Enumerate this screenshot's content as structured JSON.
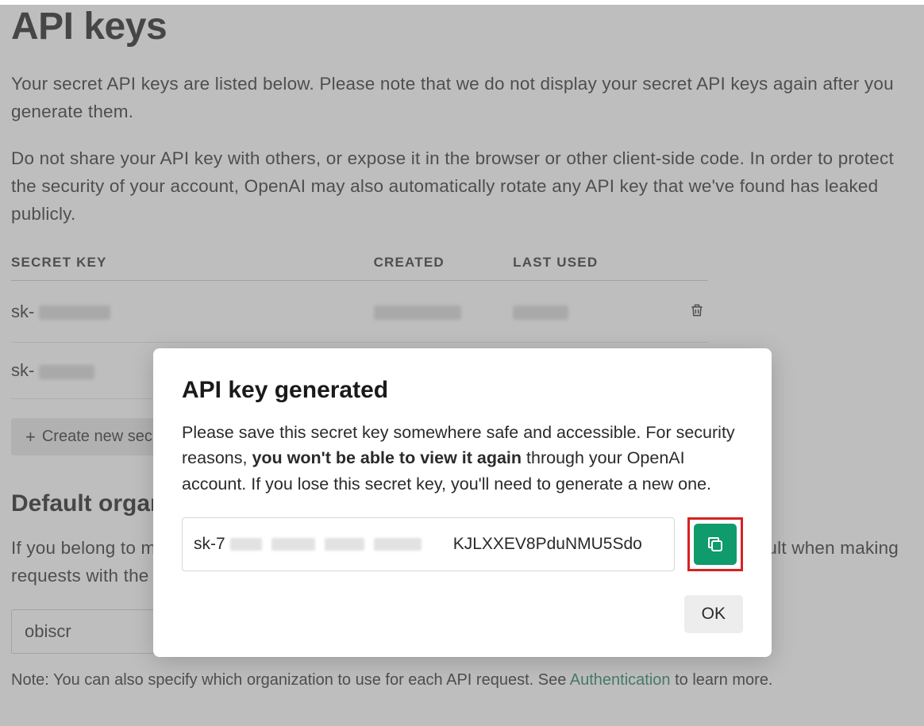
{
  "page": {
    "title": "API keys",
    "desc1": "Your secret API keys are listed below. Please note that we do not display your secret API keys again after you generate them.",
    "desc2": "Do not share your API key with others, or expose it in the browser or other client-side code. In order to protect the security of your account, OpenAI may also automatically rotate any API key that we've found has leaked publicly."
  },
  "table": {
    "headers": {
      "secret": "SECRET KEY",
      "created": "CREATED",
      "used": "LAST USED"
    },
    "rows": [
      {
        "secret_prefix": "sk-",
        "created": "",
        "used": ""
      },
      {
        "secret_prefix": "sk-",
        "created": "",
        "used": ""
      }
    ]
  },
  "create_button": "Create new secret key",
  "org": {
    "section_title": "Default organization",
    "desc": "If you belong to multiple organizations, this setting controls which organization is used by default when making requests with the API keys above.",
    "selected": "obiscr"
  },
  "footnote": {
    "prefix": "Note: You can also specify which organization to use for each API request. See ",
    "link_text": "Authentication",
    "suffix": " to learn more."
  },
  "modal": {
    "title": "API key generated",
    "text_prefix": "Please save this secret key somewhere safe and accessible. For security reasons, ",
    "text_bold": "you won't be able to view it again",
    "text_suffix": " through your OpenAI account. If you lose this secret key, you'll need to generate a new one.",
    "key_prefix": "sk-7",
    "key_suffix": "KJLXXEV8PduNMU5Sdo",
    "ok": "OK"
  }
}
